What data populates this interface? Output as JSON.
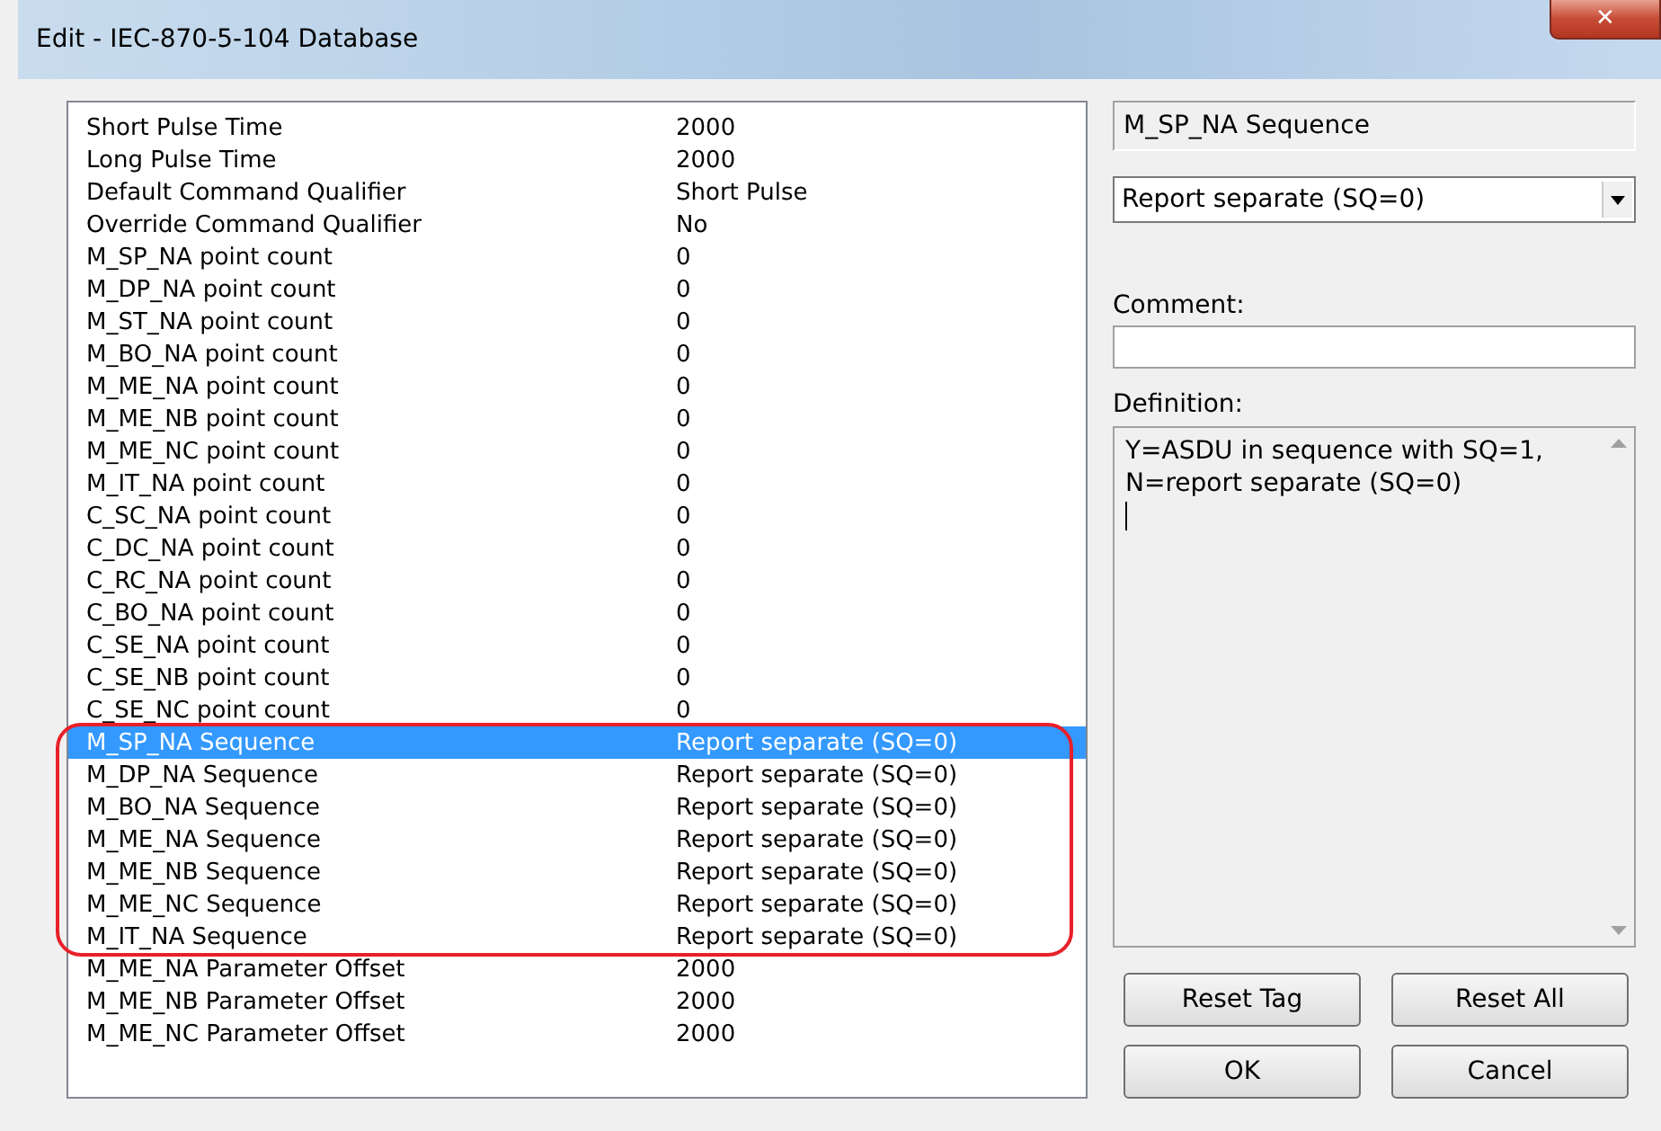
{
  "window": {
    "title": "Edit - IEC-870-5-104 Database",
    "close": "✕"
  },
  "rows": [
    {
      "name": "Short Pulse Time",
      "value": "2000",
      "selected": false
    },
    {
      "name": "Long Pulse Time",
      "value": "2000",
      "selected": false
    },
    {
      "name": "Default Command Qualifier",
      "value": "Short Pulse",
      "selected": false
    },
    {
      "name": "Override Command Qualifier",
      "value": "No",
      "selected": false
    },
    {
      "name": "M_SP_NA point count",
      "value": "0",
      "selected": false
    },
    {
      "name": "M_DP_NA point count",
      "value": "0",
      "selected": false
    },
    {
      "name": "M_ST_NA point count",
      "value": "0",
      "selected": false
    },
    {
      "name": "M_BO_NA point count",
      "value": "0",
      "selected": false
    },
    {
      "name": "M_ME_NA point count",
      "value": "0",
      "selected": false
    },
    {
      "name": "M_ME_NB point count",
      "value": "0",
      "selected": false
    },
    {
      "name": "M_ME_NC point count",
      "value": "0",
      "selected": false
    },
    {
      "name": "M_IT_NA point count",
      "value": "0",
      "selected": false
    },
    {
      "name": "C_SC_NA point count",
      "value": "0",
      "selected": false
    },
    {
      "name": "C_DC_NA point count",
      "value": "0",
      "selected": false
    },
    {
      "name": "C_RC_NA point count",
      "value": "0",
      "selected": false
    },
    {
      "name": "C_BO_NA point count",
      "value": "0",
      "selected": false
    },
    {
      "name": "C_SE_NA point count",
      "value": "0",
      "selected": false
    },
    {
      "name": "C_SE_NB point count",
      "value": "0",
      "selected": false
    },
    {
      "name": "C_SE_NC point count",
      "value": "0",
      "selected": false
    },
    {
      "name": "M_SP_NA Sequence",
      "value": "Report separate (SQ=0)",
      "selected": true
    },
    {
      "name": "M_DP_NA Sequence",
      "value": "Report separate (SQ=0)",
      "selected": false
    },
    {
      "name": "M_BO_NA Sequence",
      "value": "Report separate (SQ=0)",
      "selected": false
    },
    {
      "name": "M_ME_NA Sequence",
      "value": "Report separate (SQ=0)",
      "selected": false
    },
    {
      "name": "M_ME_NB Sequence",
      "value": "Report separate (SQ=0)",
      "selected": false
    },
    {
      "name": "M_ME_NC Sequence",
      "value": "Report separate (SQ=0)",
      "selected": false
    },
    {
      "name": "M_IT_NA Sequence",
      "value": "Report separate (SQ=0)",
      "selected": false
    },
    {
      "name": "M_ME_NA Parameter Offset",
      "value": "2000",
      "selected": false
    },
    {
      "name": "M_ME_NB Parameter Offset",
      "value": "2000",
      "selected": false
    },
    {
      "name": "M_ME_NC Parameter Offset",
      "value": "2000",
      "selected": false
    }
  ],
  "detail": {
    "field_name": "M_SP_NA Sequence",
    "dropdown_value": "Report separate (SQ=0)",
    "comment_label": "Comment:",
    "definition_label": "Definition:",
    "definition": "Y=ASDU in sequence with SQ=1, N=report separate (SQ=0)"
  },
  "buttons": [
    "Reset Tag",
    "Reset All",
    "OK",
    "Cancel"
  ]
}
